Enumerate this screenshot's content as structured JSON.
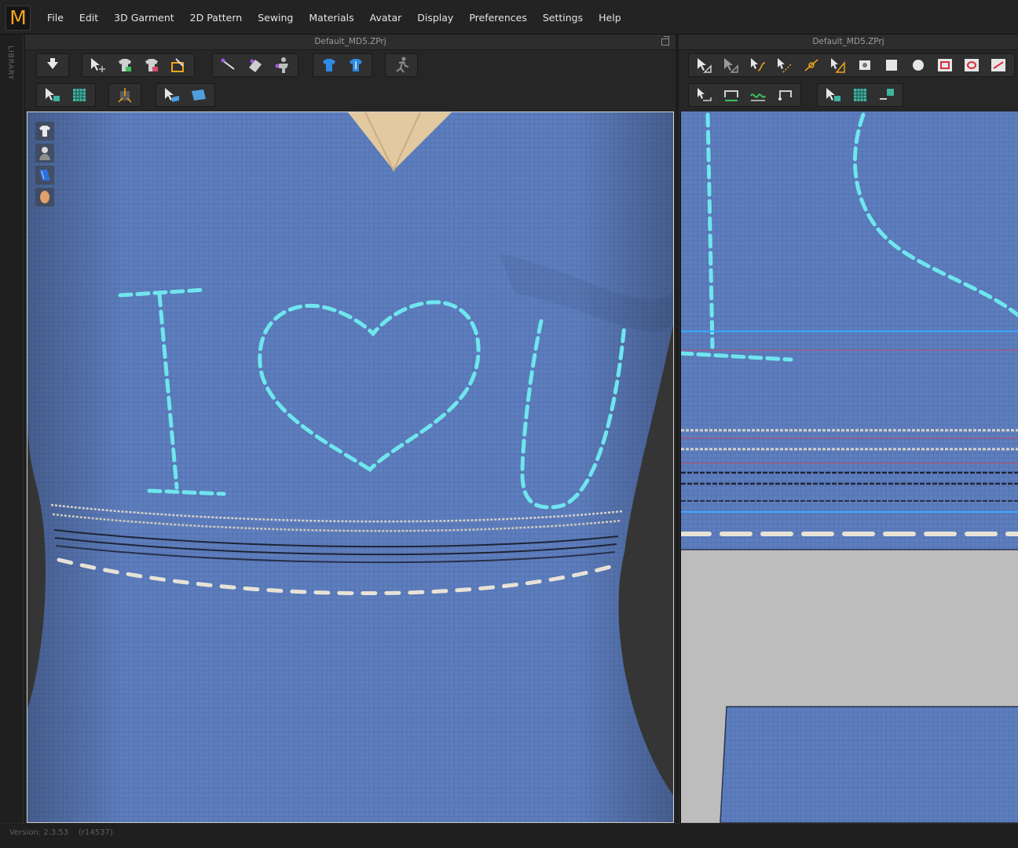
{
  "app": {
    "logo_letter": "M",
    "accent": "#f2a31d"
  },
  "menu": [
    "File",
    "Edit",
    "3D Garment",
    "2D Pattern",
    "Sewing",
    "Materials",
    "Avatar",
    "Display",
    "Preferences",
    "Settings",
    "Help"
  ],
  "sidebar": {
    "library_label": "LIBRARY"
  },
  "panels": {
    "left": {
      "title": "Default_MD5.ZPrj"
    },
    "right": {
      "title": "Default_MD5.ZPrj"
    }
  },
  "viewport": {
    "fabric_color": "#5f7fbf",
    "stitch_color": "#6fe6ee",
    "side_icons": [
      "garment-icon",
      "avatar-icon",
      "fabric-icon",
      "head-icon"
    ]
  },
  "status": {
    "version": "Version: 2.3.53",
    "build": "(r14537)"
  }
}
